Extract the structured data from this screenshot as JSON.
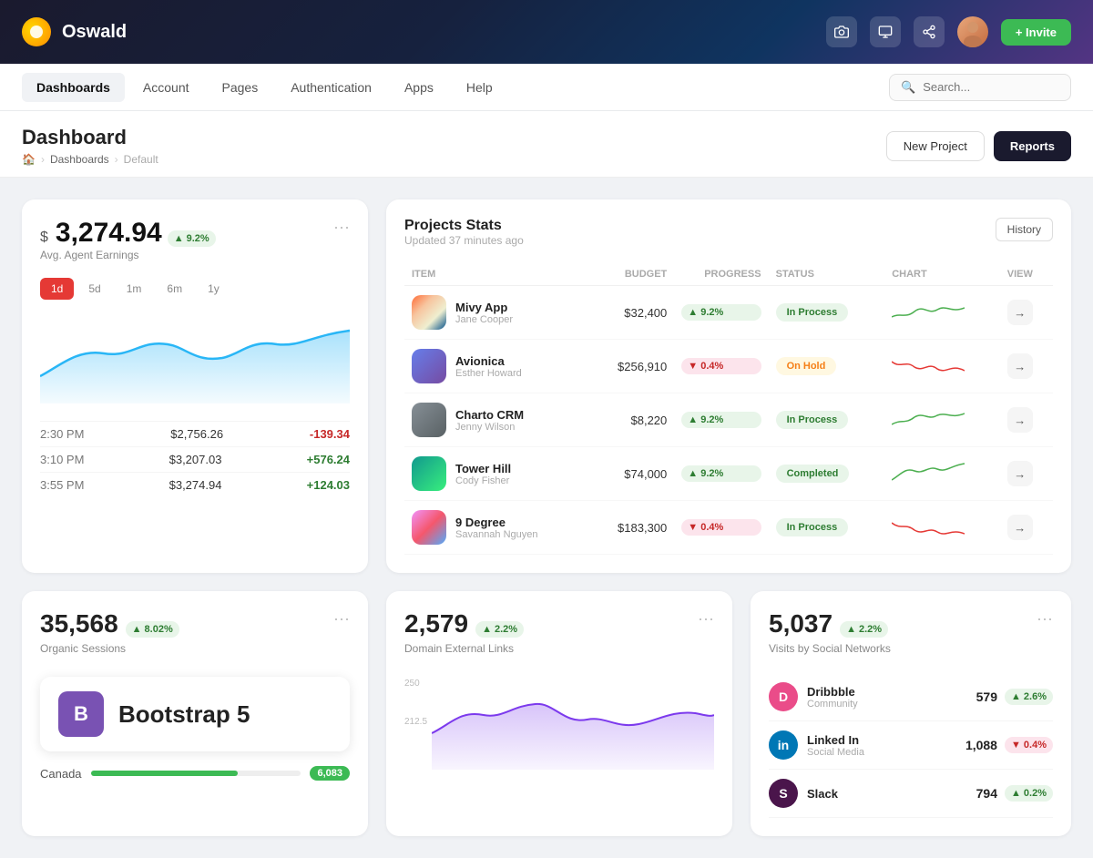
{
  "brand": {
    "name": "Oswald"
  },
  "topnav": {
    "invite_label": "+ Invite"
  },
  "menubar": {
    "items": [
      {
        "id": "dashboards",
        "label": "Dashboards",
        "active": true
      },
      {
        "id": "account",
        "label": "Account",
        "active": false
      },
      {
        "id": "pages",
        "label": "Pages",
        "active": false
      },
      {
        "id": "authentication",
        "label": "Authentication",
        "active": false
      },
      {
        "id": "apps",
        "label": "Apps",
        "active": false
      },
      {
        "id": "help",
        "label": "Help",
        "active": false
      }
    ],
    "search_placeholder": "Search..."
  },
  "page": {
    "title": "Dashboard",
    "breadcrumb": [
      "Dashboards",
      "Default"
    ],
    "btn_new_project": "New Project",
    "btn_reports": "Reports"
  },
  "earnings_card": {
    "dollar_sign": "$",
    "amount": "3,274.94",
    "badge": "9.2%",
    "label": "Avg. Agent Earnings",
    "time_tabs": [
      "1d",
      "5d",
      "1m",
      "6m",
      "1y"
    ],
    "active_tab": "1d",
    "more_icon": "•••",
    "transactions": [
      {
        "time": "2:30 PM",
        "amount": "$2,756.26",
        "change": "-139.34",
        "positive": false
      },
      {
        "time": "3:10 PM",
        "amount": "$3,207.03",
        "change": "+576.24",
        "positive": true
      },
      {
        "time": "3:55 PM",
        "amount": "$3,274.94",
        "change": "+124.03",
        "positive": true
      }
    ]
  },
  "projects_card": {
    "title": "Projects Stats",
    "updated": "Updated 37 minutes ago",
    "btn_history": "History",
    "columns": [
      "ITEM",
      "BUDGET",
      "PROGRESS",
      "STATUS",
      "CHART",
      "VIEW"
    ],
    "rows": [
      {
        "id": 1,
        "name": "Mivy App",
        "owner": "Jane Cooper",
        "budget": "$32,400",
        "progress": "9.2%",
        "progress_up": true,
        "status": "In Process",
        "status_class": "in-process",
        "thumb_class": "thumb-mivy"
      },
      {
        "id": 2,
        "name": "Avionica",
        "owner": "Esther Howard",
        "budget": "$256,910",
        "progress": "0.4%",
        "progress_up": false,
        "status": "On Hold",
        "status_class": "on-hold",
        "thumb_class": "thumb-avionica"
      },
      {
        "id": 3,
        "name": "Charto CRM",
        "owner": "Jenny Wilson",
        "budget": "$8,220",
        "progress": "9.2%",
        "progress_up": true,
        "status": "In Process",
        "status_class": "in-process",
        "thumb_class": "thumb-charto"
      },
      {
        "id": 4,
        "name": "Tower Hill",
        "owner": "Cody Fisher",
        "budget": "$74,000",
        "progress": "9.2%",
        "progress_up": true,
        "status": "Completed",
        "status_class": "completed",
        "thumb_class": "thumb-tower"
      },
      {
        "id": 5,
        "name": "9 Degree",
        "owner": "Savannah Nguyen",
        "budget": "$183,300",
        "progress": "0.4%",
        "progress_up": false,
        "status": "In Process",
        "status_class": "in-process",
        "thumb_class": "thumb-9degree"
      }
    ]
  },
  "organic_sessions": {
    "value": "35,568",
    "badge": "8.02%",
    "label": "Organic Sessions",
    "more_icon": "•••"
  },
  "domain_links": {
    "value": "2,579",
    "badge": "2.2%",
    "label": "Domain External Links",
    "chart_max": "250",
    "chart_mid": "212.5",
    "more_icon": "•••"
  },
  "social_networks": {
    "value": "5,037",
    "badge": "2.2%",
    "label": "Visits by Social Networks",
    "more_icon": "•••",
    "networks": [
      {
        "name": "Dribbble",
        "type": "Community",
        "count": "579",
        "badge": "2.6%",
        "up": true,
        "color": "#ea4c89"
      },
      {
        "name": "Linked In",
        "type": "Social Media",
        "count": "1,088",
        "badge": "0.4%",
        "up": false,
        "color": "#0077b5"
      },
      {
        "name": "Slack",
        "type": "",
        "count": "794",
        "badge": "0.2%",
        "up": true,
        "color": "#4a154b"
      }
    ]
  },
  "geo": {
    "rows": [
      {
        "country": "Canada",
        "value": "6,083",
        "pct": 70
      }
    ]
  },
  "bootstrap_banner": {
    "text": "Bootstrap 5"
  }
}
